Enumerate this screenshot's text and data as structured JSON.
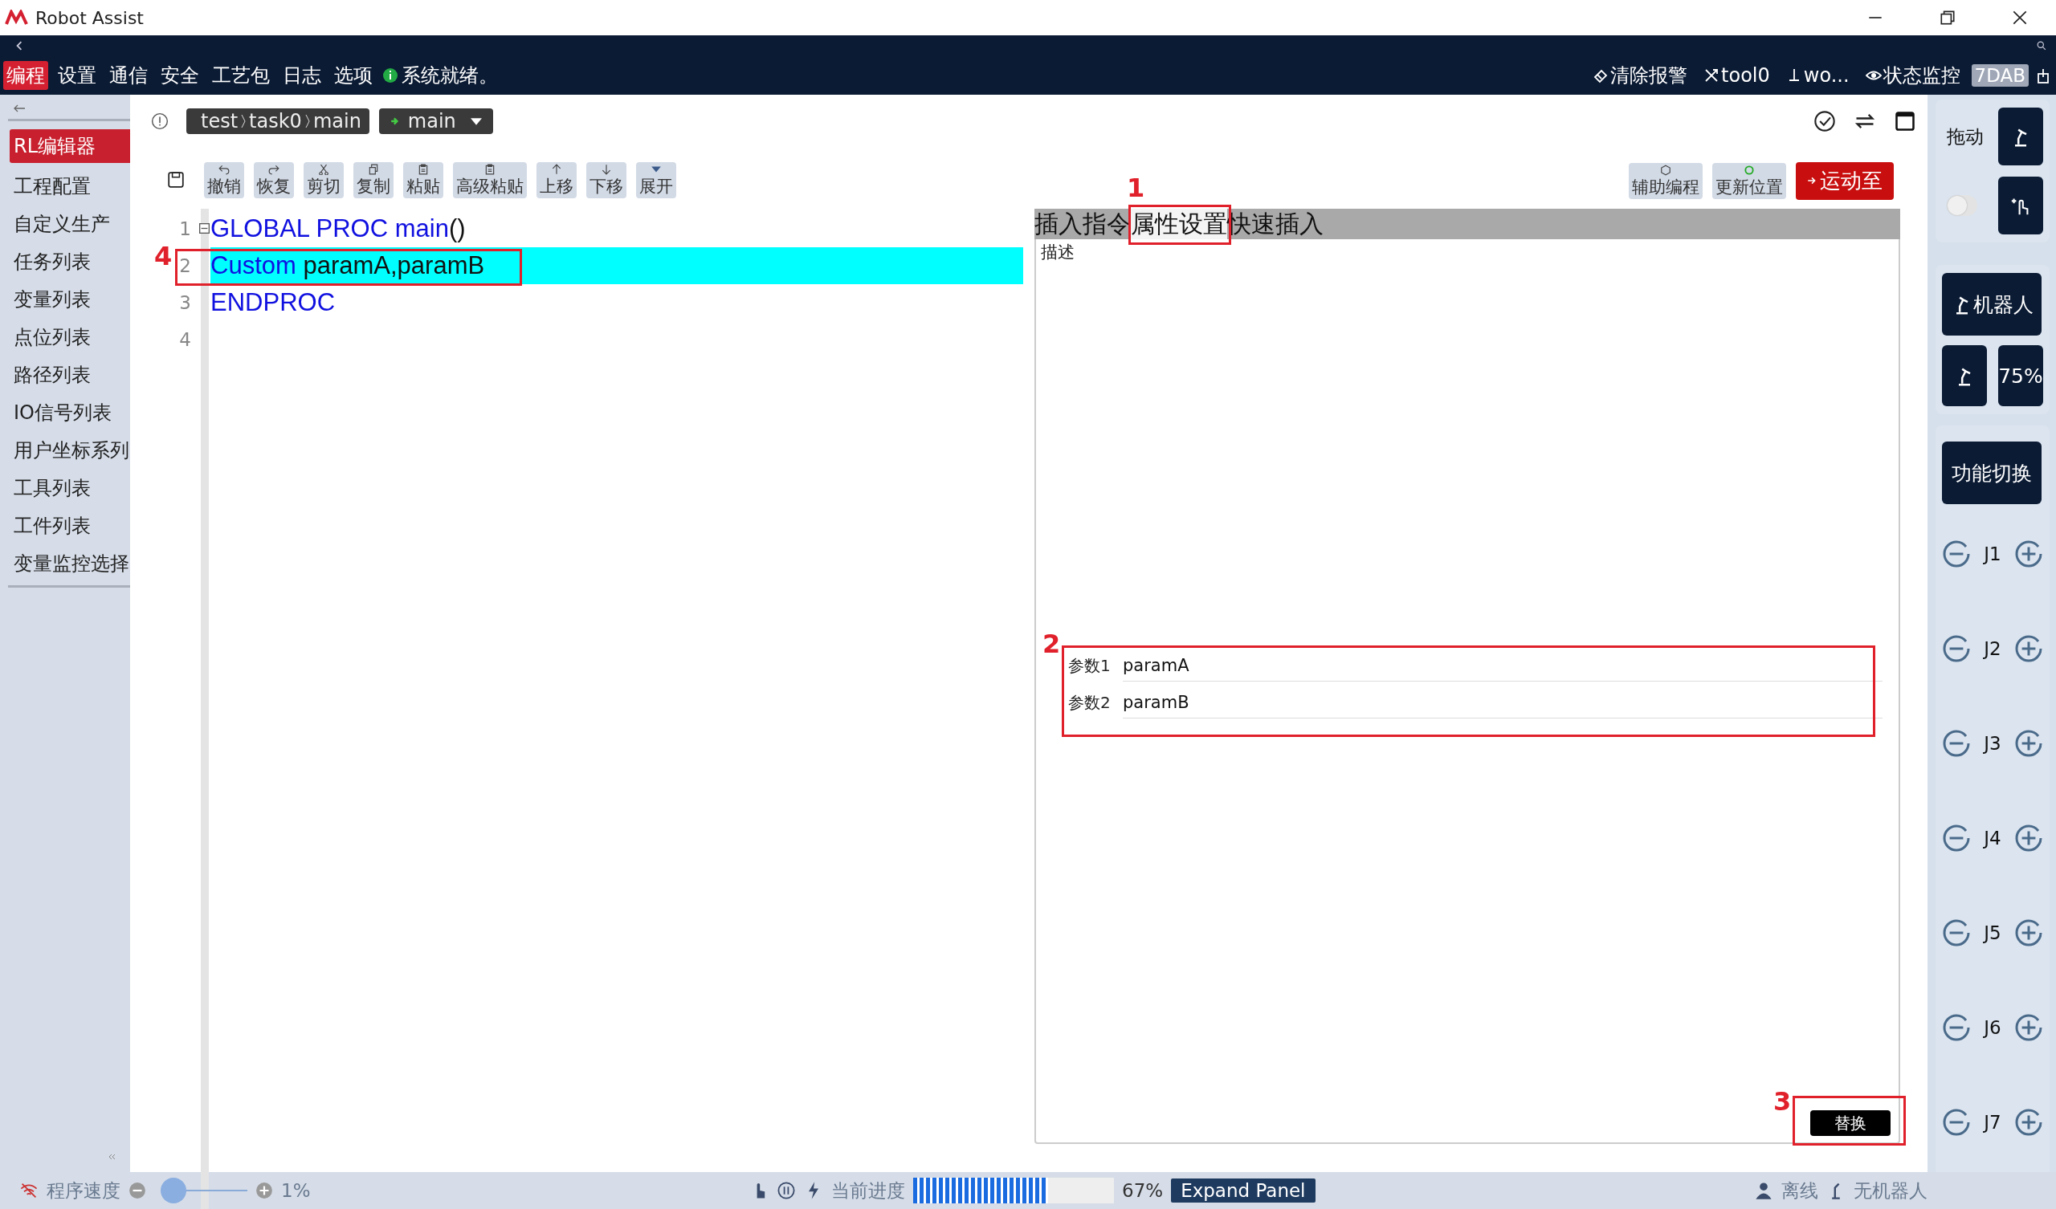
{
  "window": {
    "title": "Robot Assist"
  },
  "menu": [
    {
      "label": "编程",
      "selected": true
    },
    {
      "label": "设置",
      "selected": false
    },
    {
      "label": "通信",
      "selected": false
    },
    {
      "label": "安全",
      "selected": false
    },
    {
      "label": "工艺包",
      "selected": false
    },
    {
      "label": "日志",
      "selected": false
    },
    {
      "label": "选项",
      "selected": false
    }
  ],
  "status": "系统就绪。",
  "top_right": [
    {
      "label": "清除报警",
      "kind": "alarm"
    },
    {
      "label": "tool0",
      "kind": "tool"
    },
    {
      "label": "wo...",
      "kind": "work"
    },
    {
      "label": "状态监控",
      "kind": "eye"
    }
  ],
  "badge": "7DAB",
  "sidebar": {
    "items": [
      {
        "label": "RL编辑器",
        "selected": true
      },
      {
        "label": "工程配置",
        "selected": false
      },
      {
        "label": "自定义生产",
        "selected": false
      },
      {
        "label": "任务列表",
        "selected": false
      },
      {
        "label": "变量列表",
        "selected": false
      },
      {
        "label": "点位列表",
        "selected": false
      },
      {
        "label": "路径列表",
        "selected": false
      },
      {
        "label": "IO信号列表",
        "selected": false
      },
      {
        "label": "用户坐标系列",
        "selected": false
      },
      {
        "label": "工具列表",
        "selected": false
      },
      {
        "label": "工件列表",
        "selected": false
      },
      {
        "label": "变量监控选择",
        "selected": false
      }
    ]
  },
  "breadcrumb": [
    "test",
    "task0",
    "main"
  ],
  "routine_select": "main",
  "toolbar": [
    {
      "label": "撤销",
      "kind": "undo"
    },
    {
      "label": "恢复",
      "kind": "redo"
    },
    {
      "label": "剪切",
      "kind": "cut"
    },
    {
      "label": "复制",
      "kind": "copy"
    },
    {
      "label": "粘贴",
      "kind": "paste"
    },
    {
      "label": "高级粘贴",
      "kind": "paste"
    },
    {
      "label": "上移",
      "kind": "up"
    },
    {
      "label": "下移",
      "kind": "down"
    },
    {
      "label": "展开",
      "kind": "expand"
    }
  ],
  "right_toolbar": [
    {
      "label": "辅助编程",
      "kind": "assist"
    },
    {
      "label": "更新位置",
      "kind": "refresh"
    }
  ],
  "run_button": "运动至",
  "code": [
    {
      "number": "1",
      "foldable": true,
      "selected": false,
      "tokens": [
        {
          "text": "GLOBAL PROC main",
          "kind": "keyword"
        },
        {
          "text": "()",
          "kind": "plain"
        }
      ]
    },
    {
      "number": "2",
      "foldable": false,
      "selected": true,
      "tokens": [
        {
          "text": "Custom",
          "kind": "keyword"
        },
        {
          "text": " paramA,paramB",
          "kind": "plain"
        }
      ]
    },
    {
      "number": "3",
      "foldable": false,
      "selected": false,
      "tokens": [
        {
          "text": "ENDPROC",
          "kind": "keyword"
        }
      ]
    },
    {
      "number": "4",
      "foldable": false,
      "selected": false
    }
  ],
  "panel": {
    "tabs": [
      {
        "label": "插入指令",
        "selected": false
      },
      {
        "label": "属性设置",
        "selected": true
      },
      {
        "label": "快速插入",
        "selected": false
      }
    ],
    "description_label": "描述",
    "params": [
      {
        "label": "参数1",
        "value": "paramA"
      },
      {
        "label": "参数2",
        "value": "paramB"
      }
    ],
    "replace_button": "替换"
  },
  "annotations": [
    {
      "label": "1"
    },
    {
      "label": "2"
    },
    {
      "label": "3"
    },
    {
      "label": "4"
    }
  ],
  "jog": {
    "drag_label": "拖动",
    "drag_on": false,
    "robot_button": "机器人",
    "speed": "75%",
    "function_button": "功能切换",
    "joints": [
      "J1",
      "J2",
      "J3",
      "J4",
      "J5",
      "J6",
      "J7"
    ]
  },
  "status_bar": {
    "speed_label": "程序速度",
    "speed_slider": {
      "level": 0.02
    },
    "speed_value": "1%",
    "progress_label": "当前进度",
    "progress": {
      "level": 0.67
    },
    "progress_value": "67%",
    "expand_button": "Expand Panel",
    "connection": "离线",
    "robot": "无机器人"
  }
}
